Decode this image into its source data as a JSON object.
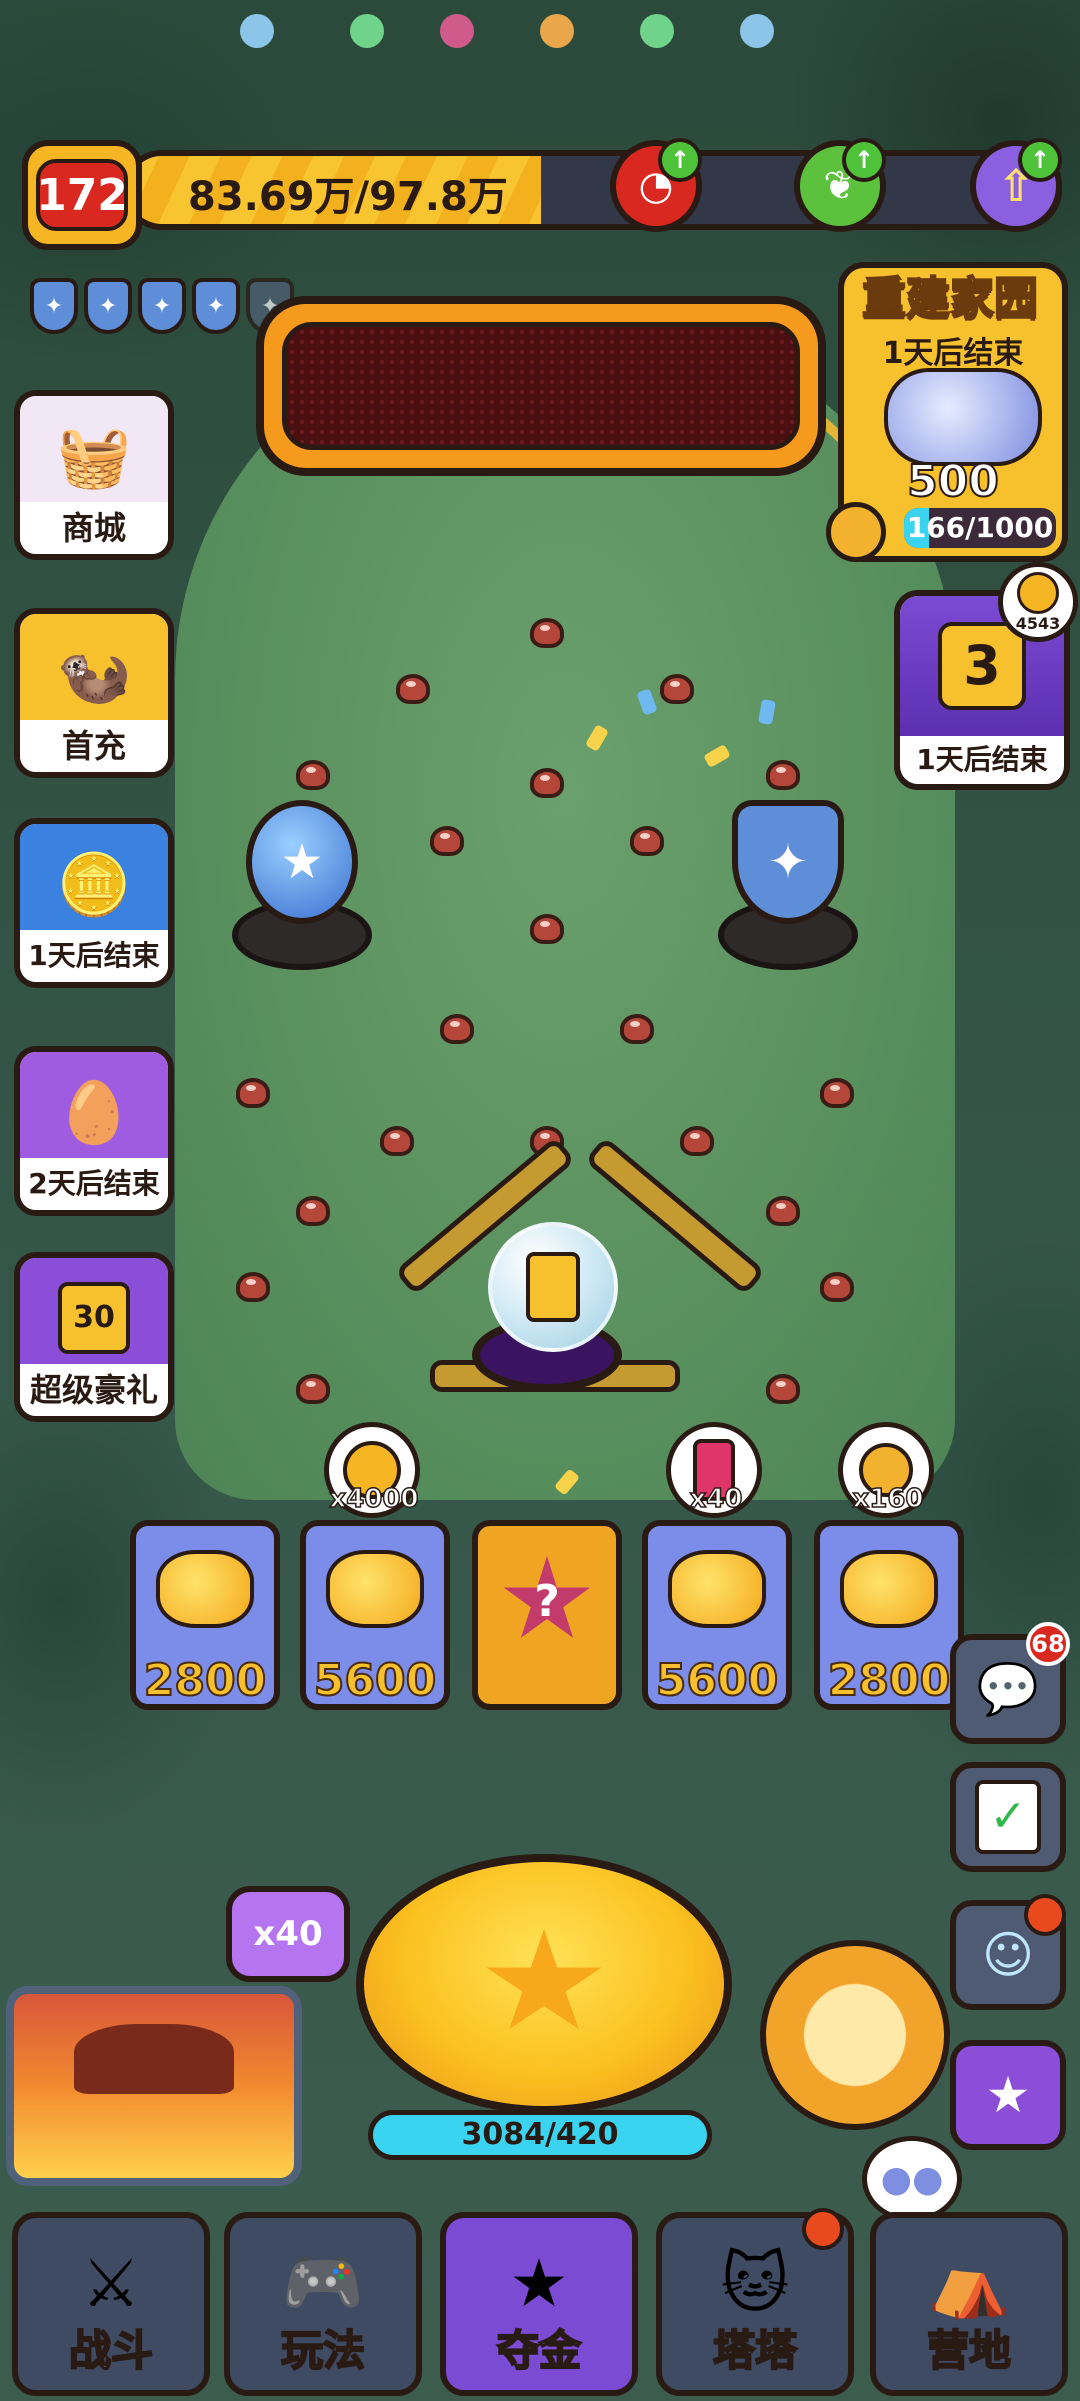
{
  "player": {
    "level": "172",
    "xp_text": "83.69万/97.8万",
    "xp_fraction": 0.856
  },
  "colors": {
    "accent": "#f6b522",
    "danger": "#d9281f",
    "nav_active": "#7b4bd3",
    "progress": "#3ad4f0"
  },
  "top_icons": [
    "red-swirl-upgrade-icon",
    "green-leaf-upgrade-icon",
    "purple-arrow-upgrade-icon"
  ],
  "shields": {
    "filled": 4,
    "total": 5
  },
  "left_menu": [
    {
      "label": "商城",
      "icon": "shop-basket-icon"
    },
    {
      "label": "首充",
      "icon": "first-recharge-creature-icon"
    },
    {
      "label": "1天后结束",
      "icon": "gold-coin-event-icon"
    },
    {
      "label": "2天后结束",
      "icon": "cat-egg-event-icon"
    },
    {
      "label": "超级豪礼",
      "icon": "super-gift-30-icon",
      "number": "30"
    }
  ],
  "event": {
    "title": "重建家园",
    "subtitle": "1天后结束",
    "reward_count": "500",
    "progress_text": "166/1000",
    "progress_fraction": 0.166
  },
  "trophy": {
    "coin_count": "4543",
    "rank": "3",
    "label": "1天后结束"
  },
  "pins": [
    {
      "icon": "gold-coin-icon",
      "mult": "x4000"
    },
    {
      "icon": "energy-can-icon",
      "mult": "x40"
    },
    {
      "icon": "golden-screw-icon",
      "mult": "x160"
    }
  ],
  "slots": [
    "2800",
    "5600",
    "?",
    "5600",
    "2800"
  ],
  "right_buttons": {
    "chat_badge": "68"
  },
  "launcher": {
    "multiplier": "x40",
    "progress_text": "3084/420"
  },
  "nav": [
    {
      "label": "战斗",
      "icon": "crossed-swords-icon"
    },
    {
      "label": "玩法",
      "icon": "gamepad-icon"
    },
    {
      "label": "夺金",
      "icon": "faces-star-icon",
      "active": true
    },
    {
      "label": "塔塔",
      "icon": "robot-cat-icon"
    },
    {
      "label": "营地",
      "icon": "tent-icon"
    }
  ]
}
